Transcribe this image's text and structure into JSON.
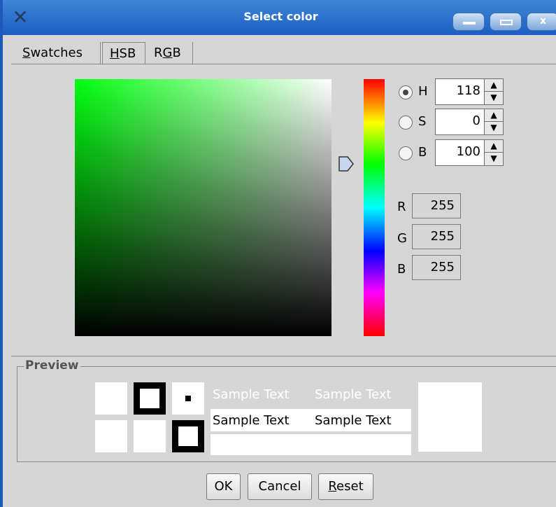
{
  "window": {
    "title": "Select color"
  },
  "tabs": [
    {
      "label": "Swatches",
      "mnemonic": "S",
      "rest": "watches"
    },
    {
      "label": "HSB",
      "mnemonic": "H",
      "rest": "SB"
    },
    {
      "label": "RGB",
      "pre": "R",
      "mnemonic": "G",
      "post": "B"
    }
  ],
  "hsb": {
    "H": {
      "label": "H",
      "value": "118",
      "selected": true
    },
    "S": {
      "label": "S",
      "value": "0",
      "selected": false
    },
    "B": {
      "label": "B",
      "value": "100",
      "selected": false
    }
  },
  "rgb": {
    "R": {
      "label": "R",
      "value": "255"
    },
    "G": {
      "label": "G",
      "value": "255"
    },
    "B": {
      "label": "B",
      "value": "255"
    }
  },
  "preview": {
    "title": "Preview",
    "sample_text": "Sample Text"
  },
  "buttons": {
    "ok": "OK",
    "cancel": "Cancel",
    "reset": "Reset",
    "reset_mnemonic": "R",
    "reset_rest": "eset"
  },
  "colors": {
    "titlebar": "#1a5fc0",
    "selected": "#ffffff"
  }
}
